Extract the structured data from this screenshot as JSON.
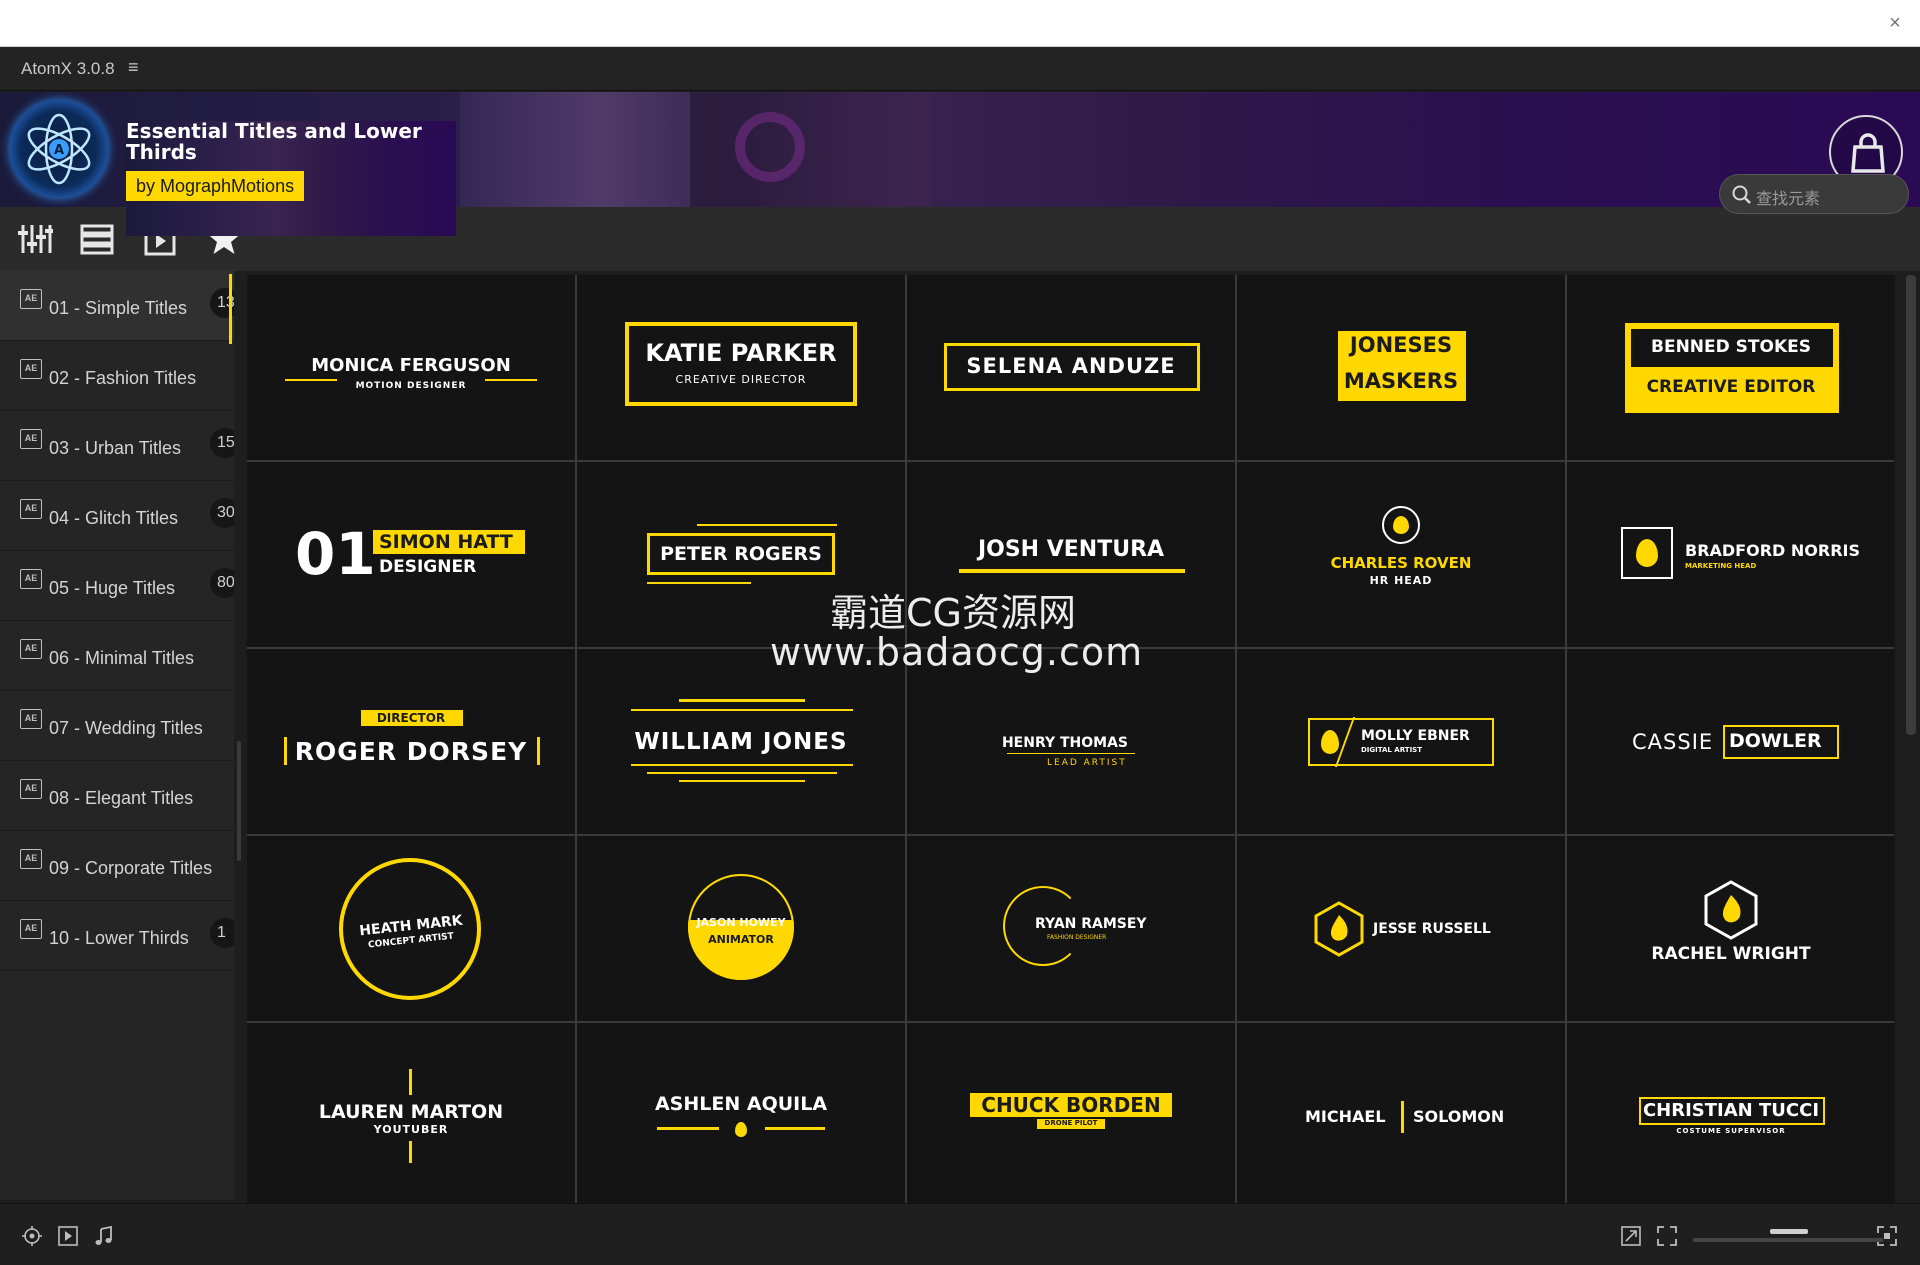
{
  "window": {
    "close_glyph": "×"
  },
  "app": {
    "name": "AtomX 3.0.8",
    "menu_glyph": "≡"
  },
  "banner": {
    "title": "Essential Titles and Lower Thirds",
    "byline": "by MographMotions",
    "cart_icon": "shopping-bag-icon"
  },
  "toolbar": {
    "icons": [
      "sliders-icon",
      "list-icon",
      "preview-icon",
      "star-icon"
    ],
    "search_placeholder": "查找元素"
  },
  "sidebar": {
    "items": [
      {
        "label": "01 - Simple Titles",
        "count": "13"
      },
      {
        "label": "02 - Fashion Titles",
        "count": ""
      },
      {
        "label": "03 - Urban Titles",
        "count": "15"
      },
      {
        "label": "04 - Glitch Titles",
        "count": "30"
      },
      {
        "label": "05 - Huge Titles",
        "count": "80"
      },
      {
        "label": "06 - Minimal Titles",
        "count": ""
      },
      {
        "label": "07 - Wedding Titles",
        "count": ""
      },
      {
        "label": "08 - Elegant Titles",
        "count": ""
      },
      {
        "label": "09 - Corporate Titles",
        "count": ""
      },
      {
        "label": "10 - Lower Thirds",
        "count": "1"
      }
    ],
    "ae_badge": "AE"
  },
  "grid": {
    "c1": {
      "name": "MONICA FERGUSON",
      "role": "MOTION DESIGNER"
    },
    "c2": {
      "name": "KATIE PARKER",
      "role": "CREATIVE DIRECTOR"
    },
    "c3": {
      "name": "SELENA ANDUZE"
    },
    "c4": {
      "line1": "JONESES",
      "line2": "MASKERS"
    },
    "c5": {
      "name": "BENNED STOKES",
      "role": "CREATIVE EDITOR"
    },
    "c6": {
      "number": "01",
      "name": "SIMON HATT",
      "role": "DESIGNER"
    },
    "c7": {
      "name": "PETER ROGERS"
    },
    "c8": {
      "name": "JOSH VENTURA"
    },
    "c9": {
      "name": "CHARLES ROVEN",
      "role": "HR HEAD"
    },
    "c10": {
      "name": "BRADFORD NORRIS",
      "role": "MARKETING HEAD"
    },
    "c11": {
      "tag": "DIRECTOR",
      "name": "ROGER DORSEY"
    },
    "c12": {
      "name": "WILLIAM JONES"
    },
    "c13": {
      "name": "HENRY THOMAS",
      "role": "LEAD ARTIST"
    },
    "c14": {
      "name": "MOLLY EBNER",
      "role": "DIGITAL ARTIST"
    },
    "c15": {
      "first": "CASSIE",
      "last": "DOWLER"
    },
    "c16": {
      "name": "HEATH MARK",
      "role": "CONCEPT ARTIST"
    },
    "c17": {
      "name": "JASON HOWEY",
      "role": "ANIMATOR"
    },
    "c18": {
      "name": "RYAN RAMSEY",
      "role": "FASHION DESIGNER"
    },
    "c19": {
      "name": "JESSE RUSSELL"
    },
    "c20": {
      "name": "RACHEL WRIGHT"
    },
    "c21": {
      "name": "LAUREN MARTON",
      "role": "YOUTUBER"
    },
    "c22": {
      "name": "ASHLEN AQUILA"
    },
    "c23": {
      "name": "CHUCK BORDEN",
      "role": "DRONE PILOT"
    },
    "c24": {
      "first": "MICHAEL",
      "last": "SOLOMON"
    },
    "c25": {
      "name": "CHRISTIAN TUCCI",
      "role": "COSTUME SUPERVISOR"
    }
  },
  "watermark": {
    "line1": "霸道CG资源网",
    "line2": "www.badaocg.com"
  },
  "statusbar": {
    "icons": [
      "target-icon",
      "play-icon",
      "music-icon",
      "expand-icon",
      "fullscreen-icon",
      "zoom-slider",
      "fit-icon"
    ]
  },
  "colors": {
    "accent": "#ffd800",
    "background": "#1e1e1e",
    "cell": "#141414"
  }
}
